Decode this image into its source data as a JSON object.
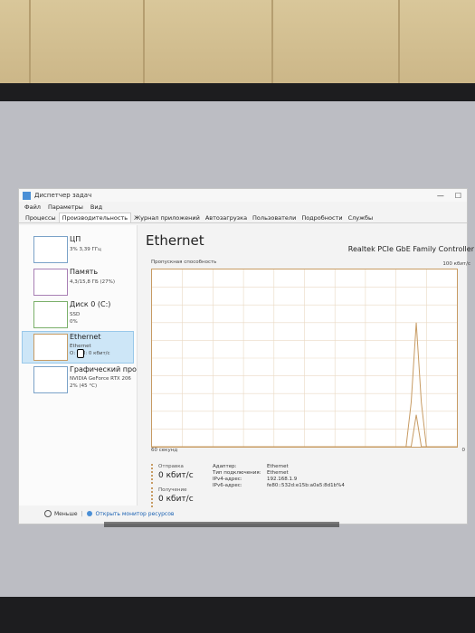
{
  "window": {
    "title": "Диспетчер задач",
    "controls": [
      "—",
      "☐"
    ]
  },
  "menu": [
    "Файл",
    "Параметры",
    "Вид"
  ],
  "tabs": [
    "Процессы",
    "Производительность",
    "Журнал приложений",
    "Автозагрузка",
    "Пользователи",
    "Подробности",
    "Службы"
  ],
  "active_tab": 1,
  "sidebar": {
    "items": [
      {
        "name": "ЦП",
        "sub1": "3% 3,39 ГГц",
        "sub2": ""
      },
      {
        "name": "Память",
        "sub1": "4,3/15,8 ГБ (27%)",
        "sub2": ""
      },
      {
        "name": "Диск 0 (C:)",
        "sub1": "SSD",
        "sub2": "0%"
      },
      {
        "name": "Ethernet",
        "sub1": "Ethernet",
        "sub2": "О: 0  П: 0 кбит/с"
      },
      {
        "name": "Графический про",
        "sub1": "NVIDIA GeForce RTX 206",
        "sub2": "2% (45 °C)"
      }
    ],
    "selected": 3
  },
  "main": {
    "title": "Ethernet",
    "adapter_name": "Realtek PCIe GbE Family Controller",
    "graph_label": "Пропускная способность",
    "graph_max": "100 кбит/с",
    "graph_time": "60 секунд",
    "graph_zero": "0"
  },
  "stats": {
    "send_label": "Отправка",
    "send_value": "0 кбит/с",
    "recv_label": "Получение",
    "recv_value": "0 кбит/с"
  },
  "details": [
    {
      "key": "Адаптер:",
      "value": "Ethernet"
    },
    {
      "key": "Тип подключения:",
      "value": "Ethernet"
    },
    {
      "key": "IPv4-адрес:",
      "value": "192.168.1.9"
    },
    {
      "key": "IPv6-адрес:",
      "value": "fe80::532d:e15b:a0a5:8d1b%4"
    }
  ],
  "footer": {
    "less": "Меньше",
    "open_monitor": "Открыть монитор ресурсов"
  },
  "chart_data": {
    "type": "line",
    "x": [
      0,
      50,
      51,
      52,
      53,
      54,
      60
    ],
    "series": [
      {
        "values": [
          0,
          0,
          25,
          70,
          25,
          0,
          0
        ]
      },
      {
        "values": [
          0,
          0,
          0,
          18,
          0,
          0,
          0
        ]
      }
    ],
    "xlim": [
      0,
      60
    ],
    "ylim": [
      0,
      100
    ],
    "grid": true,
    "colors": [
      "#c79b63",
      "#c79b63"
    ]
  }
}
